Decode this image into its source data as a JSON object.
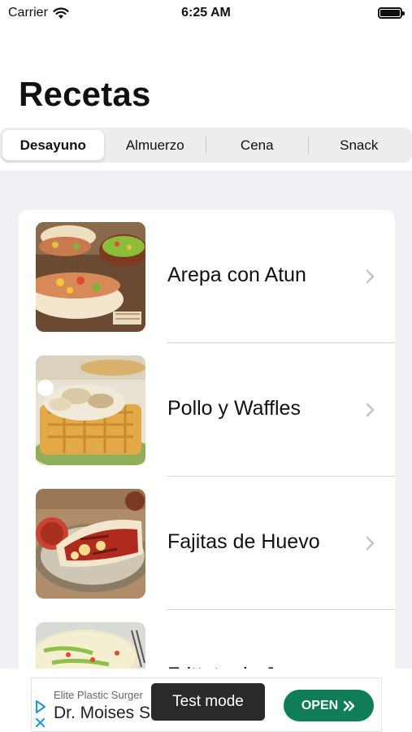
{
  "status_bar": {
    "carrier": "Carrier",
    "time": "6:25 AM",
    "icons": [
      "wifi-icon",
      "battery-icon"
    ]
  },
  "page": {
    "title": "Recetas"
  },
  "tabs": [
    {
      "label": "Desayuno",
      "selected": true
    },
    {
      "label": "Almuerzo",
      "selected": false
    },
    {
      "label": "Cena",
      "selected": false
    },
    {
      "label": "Snack",
      "selected": false
    }
  ],
  "recipes": [
    {
      "name": "Arepa con Atun",
      "thumbnail": "arepa-photo"
    },
    {
      "name": "Pollo y Waffles",
      "thumbnail": "chicken-waffles-photo"
    },
    {
      "name": "Fajitas de Huevo",
      "thumbnail": "egg-fajitas-photo"
    },
    {
      "name": "Frittata de Jamon",
      "thumbnail": "ham-frittata-photo"
    }
  ],
  "ad": {
    "advertiser": "Elite Plastic Surger",
    "headline": "Dr. Moises S",
    "test_label": "Test mode",
    "cta": "OPEN",
    "cta_color": "#0f7d58"
  },
  "colors": {
    "list_background": "#f1f1f5",
    "segmented_background": "#ededf0",
    "chevron": "#c4c4c8"
  }
}
